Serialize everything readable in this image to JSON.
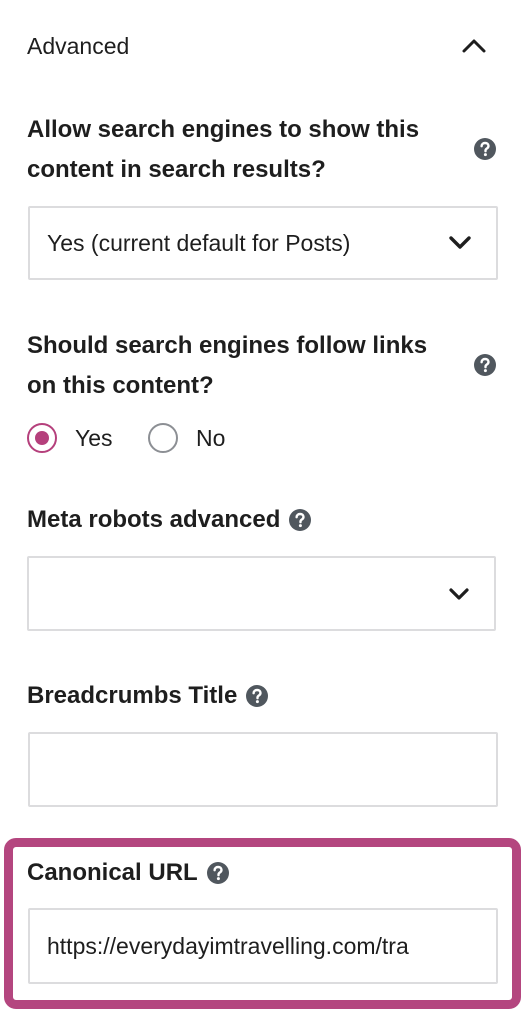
{
  "section": {
    "title": "Advanced"
  },
  "fields": {
    "allow_search": {
      "label_line1": "Allow search engines to show this",
      "label_line2": "content in search results?",
      "value": "Yes (current default for Posts)"
    },
    "follow_links": {
      "label_line1": "Should search engines follow links",
      "label_line2": "on this content?",
      "options": [
        "Yes",
        "No"
      ],
      "selected": "Yes"
    },
    "meta_robots": {
      "label": "Meta robots advanced",
      "value": ""
    },
    "breadcrumbs_title": {
      "label": "Breadcrumbs Title",
      "value": ""
    },
    "canonical_url": {
      "label": "Canonical URL",
      "value": "https://everydayimtravelling.com/tra"
    }
  },
  "colors": {
    "accent": "#b5407c",
    "highlight_frame": "#b4467f",
    "border": "#dcdcde",
    "help_icon": "#50575e",
    "text": "#1e1e1e"
  },
  "icons": {
    "collapse": "chevron-up-icon",
    "dropdown": "chevron-down-icon",
    "help": "question-circle-icon"
  }
}
